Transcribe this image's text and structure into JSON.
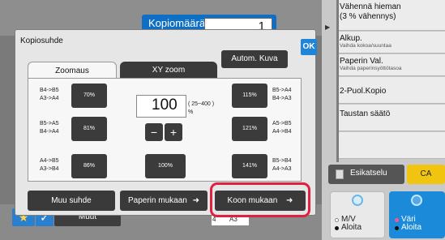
{
  "header": {
    "copies_label": "Kopiomäärä",
    "copies_value": "1"
  },
  "right_panel": {
    "items": [
      {
        "title": "Vähennä hieman",
        "title2": "(3 % vähennys)"
      },
      {
        "title": "Alkup.",
        "sub": "Vaihda kokoa/suuntaa"
      },
      {
        "title": "Paperin Val.",
        "sub": "Vaihda paperinsyöttötasoa"
      },
      {
        "title": "2-Puol.Kopio"
      },
      {
        "title": "Taustan säätö"
      }
    ],
    "preview_label": "Esikatselu",
    "ca_label": "CA",
    "bw_label1": "M/V",
    "bw_label2": "Aloita",
    "color_label1": "Väri",
    "color_label2": "Aloita"
  },
  "bottom_bar": {
    "more_label": "Muut",
    "paper_a": "4",
    "paper_b": "A3"
  },
  "dialog": {
    "title": "Kopiosuhde",
    "ok_label": "OK",
    "tabs": [
      {
        "label": "Zoomaus"
      },
      {
        "label": "XY zoom"
      }
    ],
    "auto_label": "Autom. Kuva",
    "zoom_value": "100",
    "zoom_range": "( 25~400 )",
    "zoom_unit": "%",
    "minus": "−",
    "plus": "+",
    "left_presets": [
      {
        "from": "B4->B5",
        "to": "A3->A4",
        "pct": "70%"
      },
      {
        "from": "B5->A5",
        "to": "B4->A4",
        "pct": "81%"
      },
      {
        "from": "A4->B5",
        "to": "A3->B4",
        "pct": "86%"
      }
    ],
    "center_preset": "100%",
    "right_presets": [
      {
        "pct": "115%",
        "from": "B5->A4",
        "to": "B4->A3"
      },
      {
        "pct": "121%",
        "from": "A5->B5",
        "to": "A4->B4"
      },
      {
        "pct": "141%",
        "from": "B5->B4",
        "to": "A4->A3"
      }
    ],
    "bottom_buttons": {
      "other": "Muu suhde",
      "by_paper": "Paperin mukaan",
      "by_size": "Koon mukaan"
    }
  },
  "colors": {
    "accent": "#1f85d8",
    "highlight": "#e0203f",
    "ca": "#f1c50f"
  }
}
